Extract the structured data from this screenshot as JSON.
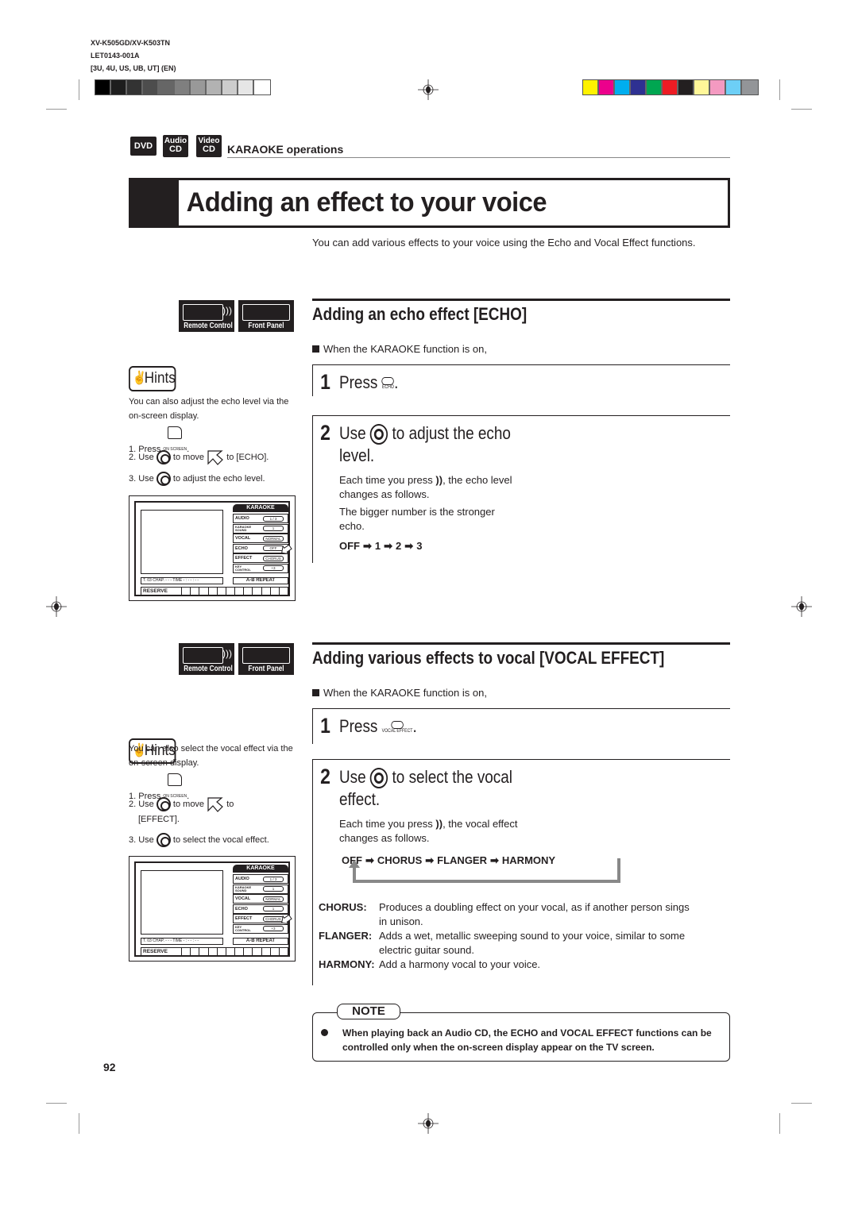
{
  "print_info": {
    "model": "XV-K505GD/XV-K503TN",
    "code": "LET0143-001A",
    "regions": "[3U, 4U, US, UB, UT]   (EN)"
  },
  "gray_swatches": [
    "#000000",
    "#1e1e1e",
    "#333333",
    "#4d4d4d",
    "#666666",
    "#7f7f7f",
    "#999999",
    "#b2b2b2",
    "#cccccc",
    "#e6e6e6",
    "#ffffff"
  ],
  "color_swatches": [
    "#fff200",
    "#ec008c",
    "#00aeef",
    "#2e3192",
    "#00a651",
    "#ed1c24",
    "#231f20",
    "#fff799",
    "#f49ac1",
    "#6dcff6",
    "#939598"
  ],
  "disc_badges": [
    {
      "line1": "DVD",
      "line2": ""
    },
    {
      "line1": "Audio",
      "line2": "CD"
    },
    {
      "line1": "Video",
      "line2": "CD"
    }
  ],
  "category": "KARAOKE operations",
  "title": "Adding an effect to your voice",
  "intro": "You can add various effects to your voice using the Echo and Vocal Effect functions.",
  "device_labels": {
    "remote": "Remote Control",
    "front": "Front Panel"
  },
  "echo": {
    "heading": "Adding an echo effect [ECHO]",
    "condition": "When the KARAOKE function is on,",
    "step1": {
      "num": "1",
      "text": "Press",
      "button_caption": "ECHO",
      "suffix": "."
    },
    "step2": {
      "num": "2",
      "text_a": "Use",
      "text_b": "to adjust the echo",
      "text_c": "level."
    },
    "desc1": "Each time you press",
    "desc1b": ", the echo level changes as follows.",
    "desc2": "The bigger number is the stronger echo.",
    "sequence": [
      "OFF",
      "1",
      "2",
      "3"
    ],
    "hints": {
      "badge": "Hints",
      "intro": "You can also adjust the echo level via the on-screen display.",
      "line1": "1. Press",
      "onscreen_caption": "ON SCREEN",
      "line2a": "2. Use",
      "line2b": "to move",
      "line2c": "to [ECHO].",
      "line3a": "3. Use",
      "line3b": "to adjust the echo level."
    },
    "osd": {
      "header": "KARAOKE",
      "rows": [
        {
          "label": "AUDIO",
          "value": "1 / 3"
        },
        {
          "label": "KARAOKE SOUND",
          "value": "1"
        },
        {
          "label": "VOCAL",
          "value": "NORMAL"
        },
        {
          "label": "ECHO",
          "value": "OFF"
        },
        {
          "label": "EFFECT",
          "value": "CHORUS"
        },
        {
          "label": "KEY CONTROL",
          "value": "+3"
        }
      ],
      "status": "T. 03  CHAP. - - -   TIME  - : - - : - -",
      "ab_repeat": "A-B REPEAT",
      "reserve": "RESERVE",
      "pointer_row": "ECHO"
    }
  },
  "vocal": {
    "heading": "Adding various effects to vocal [VOCAL EFFECT]",
    "condition": "When the KARAOKE function is on,",
    "step1": {
      "num": "1",
      "text": "Press",
      "button_caption": "VOCAL EFFECT",
      "suffix": "."
    },
    "step2": {
      "num": "2",
      "text_a": "Use",
      "text_b": "to select the vocal",
      "text_c": "effect."
    },
    "desc1": "Each time you press",
    "desc1b": ", the vocal effect changes as follows.",
    "sequence": [
      "OFF",
      "CHORUS",
      "FLANGER",
      "HARMONY"
    ],
    "definitions": [
      {
        "term": "CHORUS:",
        "text": "Produces a doubling effect on your vocal, as if another person sings",
        "text2": "in unison."
      },
      {
        "term": "FLANGER:",
        "text": "Adds a wet, metallic sweeping sound to your voice, similar to some",
        "text2": "electric guitar sound."
      },
      {
        "term": "HARMONY:",
        "text": "Add a harmony vocal to your voice.",
        "text2": ""
      }
    ],
    "hints": {
      "badge": "Hints",
      "intro": "You can also select the vocal effect via the on-screen display.",
      "line1": "1. Press",
      "onscreen_caption": "ON SCREEN",
      "line2a": "2. Use",
      "line2b": "to move",
      "line2c": "to",
      "line2d": "[EFFECT].",
      "line3a": "3. Use",
      "line3b": "to select the vocal effect."
    },
    "osd": {
      "header": "KARAOKE",
      "rows": [
        {
          "label": "AUDIO",
          "value": "1 / 3"
        },
        {
          "label": "KARAOKE SOUND",
          "value": "1"
        },
        {
          "label": "VOCAL",
          "value": "NORMAL"
        },
        {
          "label": "ECHO",
          "value": "1"
        },
        {
          "label": "EFFECT",
          "value": "CHORUS"
        },
        {
          "label": "KEY CONTROL",
          "value": "+3"
        }
      ],
      "status": "T. 03  CHAP. - - -   TIME  - : - - : - -",
      "ab_repeat": "A-B REPEAT",
      "reserve": "RESERVE",
      "pointer_row": "EFFECT"
    }
  },
  "note": {
    "label": "NOTE",
    "text": "When playing back an Audio CD, the ECHO and VOCAL EFFECT functions can be controlled only when the on-screen display appear on the TV screen."
  },
  "page_number": "92"
}
